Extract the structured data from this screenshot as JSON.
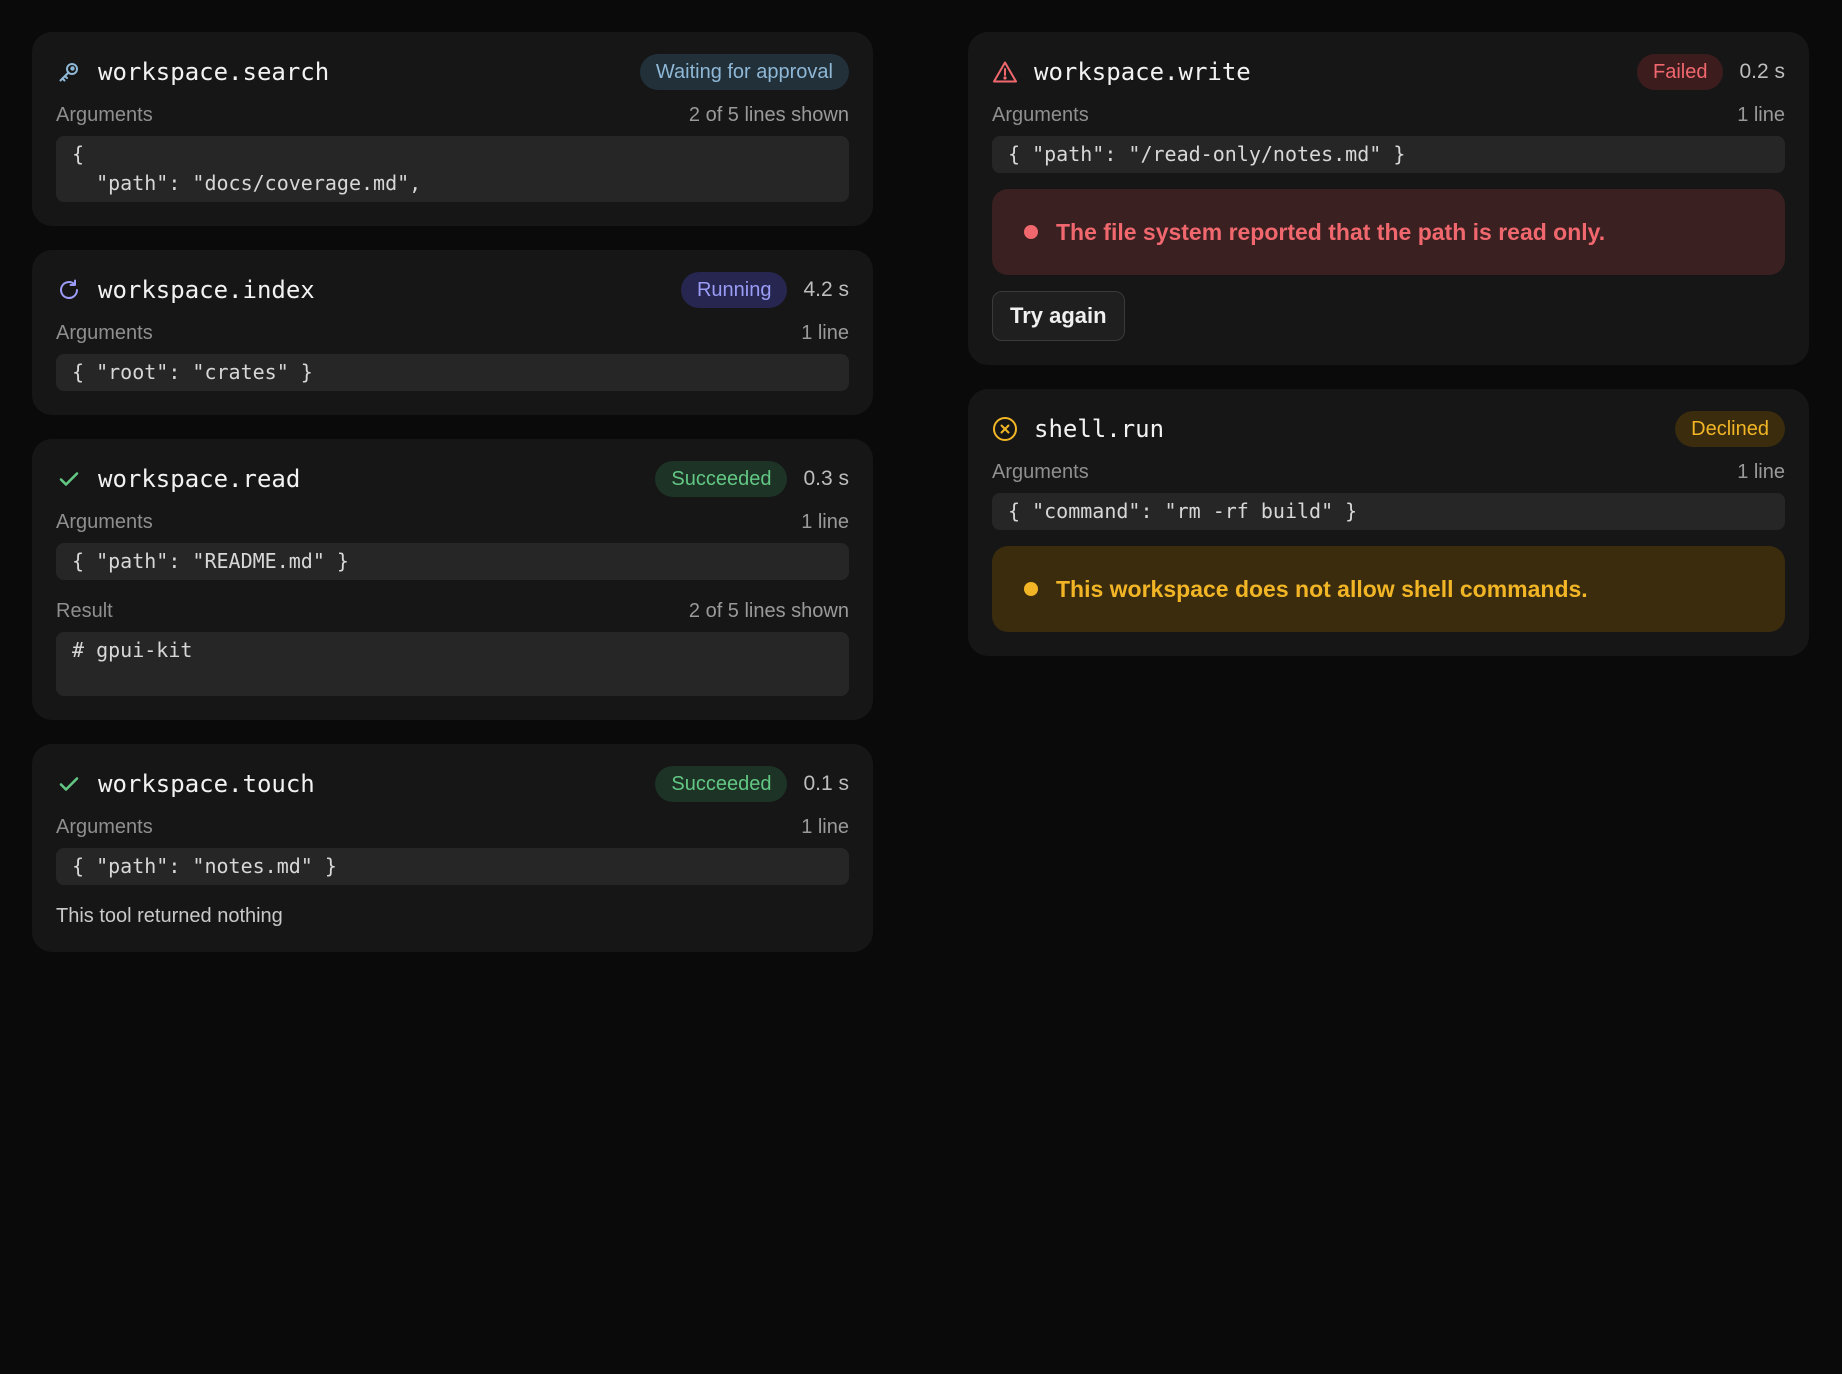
{
  "colors": {
    "background": "#0a0a0a",
    "card": "#161616",
    "waiting": "#8fb8d6",
    "running": "#9a9cf5",
    "success": "#63c784",
    "failed": "#f0686e",
    "declined": "#f2b526"
  },
  "cards": {
    "search": {
      "icon": "key-icon",
      "title": "workspace.search",
      "status": "Waiting for approval",
      "arguments_label": "Arguments",
      "arguments_meta": "2 of 5 lines shown",
      "arguments_code": "{\n  \"path\": \"docs/coverage.md\","
    },
    "index": {
      "icon": "refresh-icon",
      "title": "workspace.index",
      "status": "Running",
      "duration": "4.2 s",
      "arguments_label": "Arguments",
      "arguments_meta": "1 line",
      "arguments_code": "{ \"root\": \"crates\" }"
    },
    "read": {
      "icon": "check-icon",
      "title": "workspace.read",
      "status": "Succeeded",
      "duration": "0.3 s",
      "arguments_label": "Arguments",
      "arguments_meta": "1 line",
      "arguments_code": "{ \"path\": \"README.md\" }",
      "result_label": "Result",
      "result_meta": "2 of 5 lines shown",
      "result_code": "# gpui-kit"
    },
    "touch": {
      "icon": "check-icon",
      "title": "workspace.touch",
      "status": "Succeeded",
      "duration": "0.1 s",
      "arguments_label": "Arguments",
      "arguments_meta": "1 line",
      "arguments_code": "{ \"path\": \"notes.md\" }",
      "note": "This tool returned nothing"
    },
    "write": {
      "icon": "warning-triangle-icon",
      "title": "workspace.write",
      "status": "Failed",
      "duration": "0.2 s",
      "arguments_label": "Arguments",
      "arguments_meta": "1 line",
      "arguments_code": "{ \"path\": \"/read-only/notes.md\" }",
      "error": "The file system reported that the path is read only.",
      "retry_label": "Try again"
    },
    "shell": {
      "icon": "x-circle-icon",
      "title": "shell.run",
      "status": "Declined",
      "arguments_label": "Arguments",
      "arguments_meta": "1 line",
      "arguments_code": "{ \"command\": \"rm -rf build\" }",
      "warning": "This workspace does not allow shell commands."
    }
  }
}
